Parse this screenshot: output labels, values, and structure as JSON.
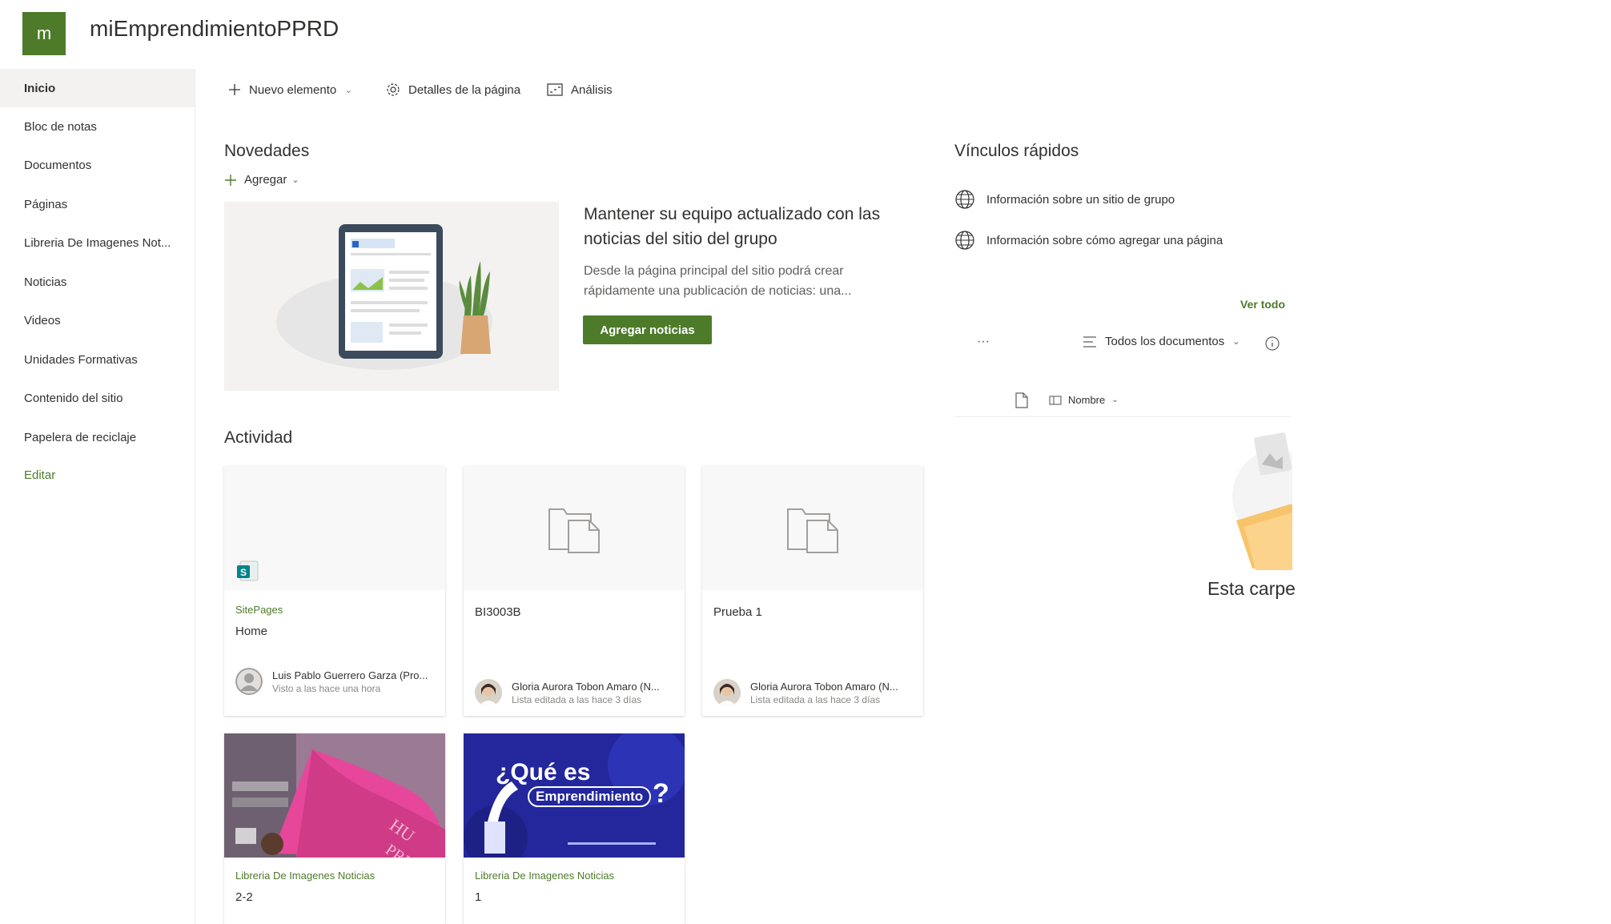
{
  "header": {
    "logo_letter": "m",
    "site_title": "miEmprendimientoPPRD"
  },
  "sidebar": {
    "items": [
      {
        "label": "Inicio",
        "active": true
      },
      {
        "label": "Bloc de notas"
      },
      {
        "label": "Documentos"
      },
      {
        "label": "Páginas"
      },
      {
        "label": "Libreria De Imagenes Not..."
      },
      {
        "label": "Noticias"
      },
      {
        "label": "Videos"
      },
      {
        "label": "Unidades Formativas"
      },
      {
        "label": "Contenido del sitio"
      },
      {
        "label": "Papelera de reciclaje"
      },
      {
        "label": "Editar"
      }
    ]
  },
  "toolbar": {
    "new_item": "Nuevo elemento",
    "page_details": "Detalles de la página",
    "analytics": "Análisis"
  },
  "news": {
    "heading": "Novedades",
    "add_label": "Agregar",
    "title": "Mantener su equipo actualizado con las noticias del sitio del grupo",
    "description": "Desde la página principal del sitio podrá crear rápidamente una publicación de noticias: una...",
    "button": "Agregar noticias"
  },
  "quick_links": {
    "heading": "Vínculos rápidos",
    "links": [
      "Información sobre un sitio de grupo",
      "Información sobre cómo agregar una página"
    ]
  },
  "documents": {
    "see_all": "Ver todo",
    "more": "···",
    "view": "Todos los documentos",
    "column_name": "Nombre",
    "empty_text": "Esta carpe"
  },
  "activity": {
    "heading": "Actividad",
    "cards": [
      {
        "source": "SitePages",
        "title": "Home",
        "author": "Luis Pablo Guerrero Garza (Pro...",
        "meta": "Visto a las hace una hora"
      },
      {
        "source": "",
        "title": "BI3003B",
        "author": "Gloria Aurora Tobon Amaro (N...",
        "meta": "Lista editada a las hace 3 días"
      },
      {
        "source": "",
        "title": "Prueba 1",
        "author": "Gloria Aurora Tobon Amaro (N...",
        "meta": "Lista editada a las hace 3 días"
      },
      {
        "source": "Libreria De Imagenes Noticias",
        "title": "2-2"
      },
      {
        "source": "Libreria De Imagenes Noticias",
        "title": "1",
        "image_text_1": "¿Qué es",
        "image_text_2": "Emprendimiento",
        "image_text_3": "?"
      }
    ]
  },
  "colors": {
    "accent": "#4d7b2a",
    "text": "#323130",
    "muted": "#605e5c",
    "banner_blue": "#23279b",
    "flag_pink": "#e7479a"
  }
}
